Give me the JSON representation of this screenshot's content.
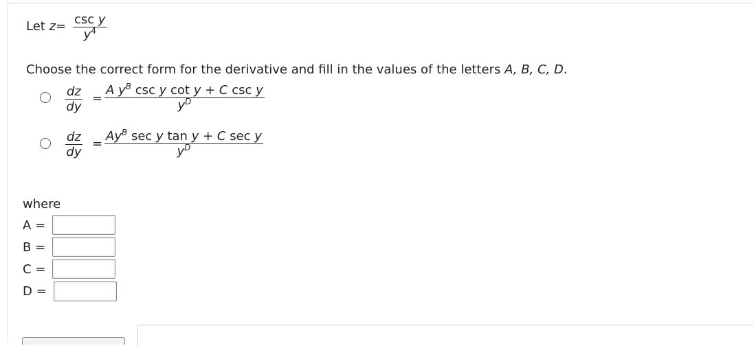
{
  "let": {
    "prefix": "Let ",
    "var": "z",
    "eq": "=",
    "num_fn": "csc",
    "num_var": "y",
    "den_var": "y",
    "den_exp": "4"
  },
  "instruction": {
    "text": "Choose the correct form for the derivative and fill in the values of the letters ",
    "letters": "A, B, C, D",
    "end": "."
  },
  "options": [
    {
      "lhs_num": "dz",
      "lhs_den": "dy",
      "eq": "=",
      "A": "A",
      "y1": "y",
      "B": "B",
      "f1": "csc",
      "v1": "y",
      "f2": "cot",
      "v2": "y",
      "plus": "+",
      "C": "C",
      "f3": "csc",
      "v3": "y",
      "den_var": "y",
      "D": "D"
    },
    {
      "lhs_num": "dz",
      "lhs_den": "dy",
      "eq": "=",
      "A": "A",
      "y1": "y",
      "B": "B",
      "f1": "sec",
      "v1": "y",
      "f2": "tan",
      "v2": "y",
      "plus": "+",
      "C": "C",
      "f3": "sec",
      "v3": "y",
      "den_var": "y",
      "D": "D"
    }
  ],
  "where_label": "where",
  "fields": [
    {
      "label": "A",
      "eq": "=",
      "value": ""
    },
    {
      "label": "B",
      "eq": "=",
      "value": ""
    },
    {
      "label": "C",
      "eq": "=",
      "value": ""
    },
    {
      "label": "D",
      "eq": "=",
      "value": ""
    }
  ]
}
